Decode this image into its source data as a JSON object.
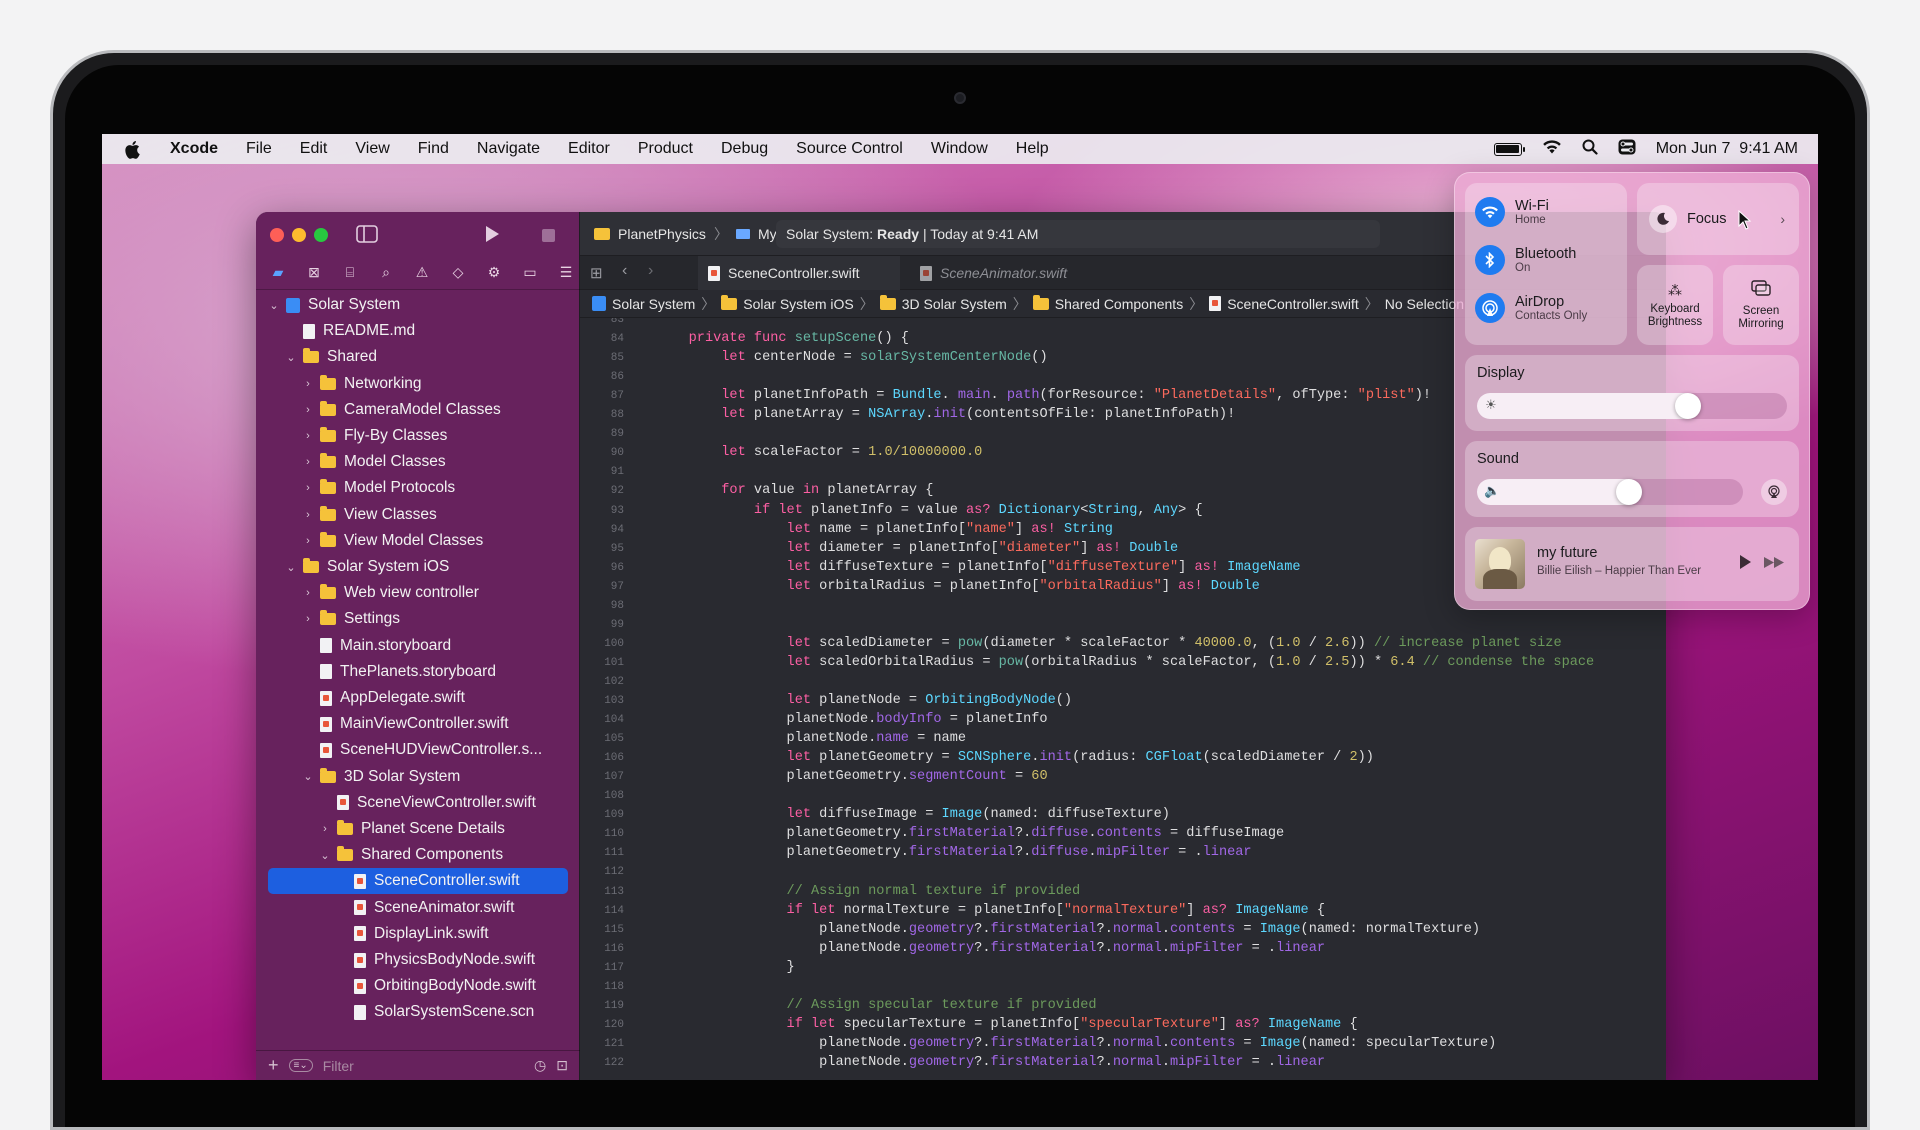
{
  "menubar": {
    "app_name": "Xcode",
    "menus": [
      "File",
      "Edit",
      "View",
      "Find",
      "Navigate",
      "Editor",
      "Product",
      "Debug",
      "Source Control",
      "Window",
      "Help"
    ],
    "clock": "Mon Jun 7  9:41 AM"
  },
  "toolbar": {
    "scheme": "PlanetPhysics",
    "destination": "My Mac",
    "status_prefix": "Solar System: ",
    "status_state": "Ready",
    "status_suffix": " | Today at 9:41 AM"
  },
  "tabs": [
    {
      "label": "SceneController.swift",
      "active": true
    },
    {
      "label": "SceneAnimator.swift",
      "active": false
    }
  ],
  "jumpbar": [
    "Solar System",
    "Solar System iOS",
    "3D Solar System",
    "Shared Components",
    "SceneController.swift",
    "No Selection"
  ],
  "navigator": {
    "filter_placeholder": "Filter",
    "items": [
      {
        "label": "Solar System",
        "level": 0,
        "type": "project",
        "expanded": true
      },
      {
        "label": "README.md",
        "level": 1,
        "type": "file"
      },
      {
        "label": "Shared",
        "level": 1,
        "type": "folder",
        "expanded": true
      },
      {
        "label": "Networking",
        "level": 2,
        "type": "folder",
        "expanded": false
      },
      {
        "label": "CameraModel Classes",
        "level": 2,
        "type": "folder",
        "expanded": false
      },
      {
        "label": "Fly-By Classes",
        "level": 2,
        "type": "folder",
        "expanded": false
      },
      {
        "label": "Model Classes",
        "level": 2,
        "type": "folder",
        "expanded": false
      },
      {
        "label": "Model Protocols",
        "level": 2,
        "type": "folder",
        "expanded": false
      },
      {
        "label": "View Classes",
        "level": 2,
        "type": "folder",
        "expanded": false
      },
      {
        "label": "View Model Classes",
        "level": 2,
        "type": "folder",
        "expanded": false
      },
      {
        "label": "Solar System iOS",
        "level": 1,
        "type": "folder",
        "expanded": true
      },
      {
        "label": "Web view controller",
        "level": 2,
        "type": "folder",
        "expanded": false
      },
      {
        "label": "Settings",
        "level": 2,
        "type": "folder",
        "expanded": false
      },
      {
        "label": "Main.storyboard",
        "level": 2,
        "type": "file"
      },
      {
        "label": "ThePlanets.storyboard",
        "level": 2,
        "type": "file"
      },
      {
        "label": "AppDelegate.swift",
        "level": 2,
        "type": "swift"
      },
      {
        "label": "MainViewController.swift",
        "level": 2,
        "type": "swift"
      },
      {
        "label": "SceneHUDViewController.s...",
        "level": 2,
        "type": "swift"
      },
      {
        "label": "3D Solar System",
        "level": 2,
        "type": "folder",
        "expanded": true
      },
      {
        "label": "SceneViewController.swift",
        "level": 3,
        "type": "swift"
      },
      {
        "label": "Planet Scene Details",
        "level": 3,
        "type": "folder",
        "expanded": false
      },
      {
        "label": "Shared Components",
        "level": 3,
        "type": "folder",
        "expanded": true
      },
      {
        "label": "SceneController.swift",
        "level": 4,
        "type": "swift",
        "selected": true
      },
      {
        "label": "SceneAnimator.swift",
        "level": 4,
        "type": "swift"
      },
      {
        "label": "DisplayLink.swift",
        "level": 4,
        "type": "swift"
      },
      {
        "label": "PhysicsBodyNode.swift",
        "level": 4,
        "type": "swift"
      },
      {
        "label": "OrbitingBodyNode.swift",
        "level": 4,
        "type": "swift"
      },
      {
        "label": "SolarSystemScene.scn",
        "level": 4,
        "type": "file"
      }
    ]
  },
  "code": [
    {
      "n": "83",
      "tokens": []
    },
    {
      "n": "84",
      "tokens": [
        [
          "",
          "    "
        ],
        [
          "kw",
          "private func "
        ],
        [
          "fn",
          "setupScene"
        ],
        [
          "",
          "() {"
        ]
      ]
    },
    {
      "n": "85",
      "tokens": [
        [
          "",
          "        "
        ],
        [
          "kw",
          "let "
        ],
        [
          "",
          "centerNode = "
        ],
        [
          "fn",
          "solarSystemCenterNode"
        ],
        [
          "",
          "()"
        ]
      ]
    },
    {
      "n": "86",
      "tokens": []
    },
    {
      "n": "87",
      "tokens": [
        [
          "",
          "        "
        ],
        [
          "kw",
          "let "
        ],
        [
          "",
          "planetInfoPath = "
        ],
        [
          "ty",
          "Bundle"
        ],
        [
          "",
          ". "
        ],
        [
          "pr",
          "main"
        ],
        [
          "",
          ". "
        ],
        [
          "pr",
          "path"
        ],
        [
          "",
          "(forResource: "
        ],
        [
          "st",
          "\"PlanetDetails\""
        ],
        [
          "",
          ", ofType: "
        ],
        [
          "st",
          "\"plist\""
        ],
        [
          "",
          ")!"
        ]
      ]
    },
    {
      "n": "88",
      "tokens": [
        [
          "",
          "        "
        ],
        [
          "kw",
          "let "
        ],
        [
          "",
          "planetArray = "
        ],
        [
          "ty",
          "NSArray"
        ],
        [
          "",
          "."
        ],
        [
          "pr",
          "init"
        ],
        [
          "",
          "(contentsOfFile: planetInfoPath)!"
        ]
      ]
    },
    {
      "n": "89",
      "tokens": []
    },
    {
      "n": "90",
      "tokens": [
        [
          "",
          "        "
        ],
        [
          "kw",
          "let "
        ],
        [
          "",
          "scaleFactor = "
        ],
        [
          "nu",
          "1.0/10000000.0"
        ]
      ]
    },
    {
      "n": "91",
      "tokens": []
    },
    {
      "n": "92",
      "tokens": [
        [
          "",
          "        "
        ],
        [
          "kw",
          "for "
        ],
        [
          "",
          "value "
        ],
        [
          "kw",
          "in "
        ],
        [
          "",
          "planetArray {"
        ]
      ]
    },
    {
      "n": "93",
      "tokens": [
        [
          "",
          "            "
        ],
        [
          "kw",
          "if let "
        ],
        [
          "",
          "planetInfo = value "
        ],
        [
          "kw",
          "as? "
        ],
        [
          "ty",
          "Dictionary"
        ],
        [
          "",
          "<"
        ],
        [
          "ty",
          "String"
        ],
        [
          "",
          ", "
        ],
        [
          "ty",
          "Any"
        ],
        [
          "",
          "> {"
        ]
      ]
    },
    {
      "n": "94",
      "tokens": [
        [
          "",
          "                "
        ],
        [
          "kw",
          "let "
        ],
        [
          "",
          "name = planetInfo["
        ],
        [
          "st",
          "\"name\""
        ],
        [
          "",
          "] "
        ],
        [
          "kw",
          "as! "
        ],
        [
          "ty",
          "String"
        ]
      ]
    },
    {
      "n": "95",
      "tokens": [
        [
          "",
          "                "
        ],
        [
          "kw",
          "let "
        ],
        [
          "",
          "diameter = planetInfo["
        ],
        [
          "st",
          "\"diameter\""
        ],
        [
          "",
          "] "
        ],
        [
          "kw",
          "as! "
        ],
        [
          "ty",
          "Double"
        ]
      ]
    },
    {
      "n": "96",
      "tokens": [
        [
          "",
          "                "
        ],
        [
          "kw",
          "let "
        ],
        [
          "",
          "diffuseTexture = planetInfo["
        ],
        [
          "st",
          "\"diffuseTexture\""
        ],
        [
          "",
          "] "
        ],
        [
          "kw",
          "as! "
        ],
        [
          "ty",
          "ImageName"
        ]
      ]
    },
    {
      "n": "97",
      "tokens": [
        [
          "",
          "                "
        ],
        [
          "kw",
          "let "
        ],
        [
          "",
          "orbitalRadius = planetInfo["
        ],
        [
          "st",
          "\"orbitalRadius\""
        ],
        [
          "",
          "] "
        ],
        [
          "kw",
          "as! "
        ],
        [
          "ty",
          "Double"
        ]
      ]
    },
    {
      "n": "98",
      "tokens": []
    },
    {
      "n": "99",
      "tokens": []
    },
    {
      "n": "100",
      "tokens": [
        [
          "",
          "                "
        ],
        [
          "kw",
          "let "
        ],
        [
          "",
          "scaledDiameter = "
        ],
        [
          "fn",
          "pow"
        ],
        [
          "",
          "(diameter * scaleFactor * "
        ],
        [
          "nu",
          "40000.0"
        ],
        [
          "",
          ", ("
        ],
        [
          "nu",
          "1.0"
        ],
        [
          "",
          " / "
        ],
        [
          "nu",
          "2.6"
        ],
        [
          "",
          "))"
        ],
        [
          "cm",
          " // increase planet size"
        ]
      ]
    },
    {
      "n": "101",
      "tokens": [
        [
          "",
          "                "
        ],
        [
          "kw",
          "let "
        ],
        [
          "",
          "scaledOrbitalRadius = "
        ],
        [
          "fn",
          "pow"
        ],
        [
          "",
          "(orbitalRadius * scaleFactor, ("
        ],
        [
          "nu",
          "1.0"
        ],
        [
          "",
          " / "
        ],
        [
          "nu",
          "2.5"
        ],
        [
          "",
          ")) * "
        ],
        [
          "nu",
          "6.4"
        ],
        [
          "cm",
          " // condense the space"
        ]
      ]
    },
    {
      "n": "102",
      "tokens": []
    },
    {
      "n": "103",
      "tokens": [
        [
          "",
          "                "
        ],
        [
          "kw",
          "let "
        ],
        [
          "",
          "planetNode = "
        ],
        [
          "ty",
          "OrbitingBodyNode"
        ],
        [
          "",
          "()"
        ]
      ]
    },
    {
      "n": "104",
      "tokens": [
        [
          "",
          "                planetNode."
        ],
        [
          "pr",
          "bodyInfo"
        ],
        [
          "",
          " = planetInfo"
        ]
      ]
    },
    {
      "n": "105",
      "tokens": [
        [
          "",
          "                planetNode."
        ],
        [
          "pr",
          "name"
        ],
        [
          "",
          " = name"
        ]
      ]
    },
    {
      "n": "106",
      "tokens": [
        [
          "",
          "                "
        ],
        [
          "kw",
          "let "
        ],
        [
          "",
          "planetGeometry = "
        ],
        [
          "ty",
          "SCNSphere"
        ],
        [
          "",
          "."
        ],
        [
          "pr",
          "init"
        ],
        [
          "",
          "(radius: "
        ],
        [
          "ty",
          "CGFloat"
        ],
        [
          "",
          "(scaledDiameter / "
        ],
        [
          "nu",
          "2"
        ],
        [
          "",
          "))"
        ]
      ]
    },
    {
      "n": "107",
      "tokens": [
        [
          "",
          "                planetGeometry."
        ],
        [
          "pr",
          "segmentCount"
        ],
        [
          "",
          " = "
        ],
        [
          "nu",
          "60"
        ]
      ]
    },
    {
      "n": "108",
      "tokens": []
    },
    {
      "n": "109",
      "tokens": [
        [
          "",
          "                "
        ],
        [
          "kw",
          "let "
        ],
        [
          "",
          "diffuseImage = "
        ],
        [
          "ty",
          "Image"
        ],
        [
          "",
          "(named: diffuseTexture)"
        ]
      ]
    },
    {
      "n": "110",
      "tokens": [
        [
          "",
          "                planetGeometry."
        ],
        [
          "pr",
          "firstMaterial"
        ],
        [
          "",
          "?."
        ],
        [
          "pr",
          "diffuse"
        ],
        [
          "",
          "."
        ],
        [
          "pr",
          "contents"
        ],
        [
          "",
          " = diffuseImage"
        ]
      ]
    },
    {
      "n": "111",
      "tokens": [
        [
          "",
          "                planetGeometry."
        ],
        [
          "pr",
          "firstMaterial"
        ],
        [
          "",
          "?."
        ],
        [
          "pr",
          "diffuse"
        ],
        [
          "",
          "."
        ],
        [
          "pr",
          "mipFilter"
        ],
        [
          "",
          " = ."
        ],
        [
          "pr",
          "linear"
        ]
      ]
    },
    {
      "n": "112",
      "tokens": []
    },
    {
      "n": "113",
      "tokens": [
        [
          "cm",
          "                // Assign normal texture if provided"
        ]
      ]
    },
    {
      "n": "114",
      "tokens": [
        [
          "",
          "                "
        ],
        [
          "kw",
          "if let "
        ],
        [
          "",
          "normalTexture = planetInfo["
        ],
        [
          "st",
          "\"normalTexture\""
        ],
        [
          "",
          "] "
        ],
        [
          "kw",
          "as? "
        ],
        [
          "ty",
          "ImageName"
        ],
        [
          "",
          " {"
        ]
      ]
    },
    {
      "n": "115",
      "tokens": [
        [
          "",
          "                    planetNode."
        ],
        [
          "pr",
          "geometry"
        ],
        [
          "",
          "?."
        ],
        [
          "pr",
          "firstMaterial"
        ],
        [
          "",
          "?."
        ],
        [
          "pr",
          "normal"
        ],
        [
          "",
          "."
        ],
        [
          "pr",
          "contents"
        ],
        [
          "",
          " = "
        ],
        [
          "ty",
          "Image"
        ],
        [
          "",
          "(named: normalTexture)"
        ]
      ]
    },
    {
      "n": "116",
      "tokens": [
        [
          "",
          "                    planetNode."
        ],
        [
          "pr",
          "geometry"
        ],
        [
          "",
          "?."
        ],
        [
          "pr",
          "firstMaterial"
        ],
        [
          "",
          "?."
        ],
        [
          "pr",
          "normal"
        ],
        [
          "",
          "."
        ],
        [
          "pr",
          "mipFilter"
        ],
        [
          "",
          " = ."
        ],
        [
          "pr",
          "linear"
        ]
      ]
    },
    {
      "n": "117",
      "tokens": [
        [
          "",
          "                }"
        ]
      ]
    },
    {
      "n": "118",
      "tokens": []
    },
    {
      "n": "119",
      "tokens": [
        [
          "cm",
          "                // Assign specular texture if provided"
        ]
      ]
    },
    {
      "n": "120",
      "tokens": [
        [
          "",
          "                "
        ],
        [
          "kw",
          "if let "
        ],
        [
          "",
          "specularTexture = planetInfo["
        ],
        [
          "st",
          "\"specularTexture\""
        ],
        [
          "",
          "] "
        ],
        [
          "kw",
          "as? "
        ],
        [
          "ty",
          "ImageName"
        ],
        [
          "",
          " {"
        ]
      ]
    },
    {
      "n": "121",
      "tokens": [
        [
          "",
          "                    planetNode."
        ],
        [
          "pr",
          "geometry"
        ],
        [
          "",
          "?."
        ],
        [
          "pr",
          "firstMaterial"
        ],
        [
          "",
          "?."
        ],
        [
          "pr",
          "normal"
        ],
        [
          "",
          "."
        ],
        [
          "pr",
          "contents"
        ],
        [
          "",
          " = "
        ],
        [
          "ty",
          "Image"
        ],
        [
          "",
          "(named: specularTexture)"
        ]
      ]
    },
    {
      "n": "122",
      "tokens": [
        [
          "",
          "                    planetNode."
        ],
        [
          "pr",
          "geometry"
        ],
        [
          "",
          "?."
        ],
        [
          "pr",
          "firstMaterial"
        ],
        [
          "",
          "?."
        ],
        [
          "pr",
          "normal"
        ],
        [
          "",
          "."
        ],
        [
          "pr",
          "mipFilter"
        ],
        [
          "",
          " = ."
        ],
        [
          "pr",
          "linear"
        ]
      ]
    }
  ],
  "control_center": {
    "wifi": {
      "title": "Wi-Fi",
      "sub": "Home"
    },
    "bluetooth": {
      "title": "Bluetooth",
      "sub": "On"
    },
    "airdrop": {
      "title": "AirDrop",
      "sub": "Contacts Only"
    },
    "focus": {
      "title": "Focus"
    },
    "keyboard_brightness": "Keyboard\nBrightness",
    "screen_mirroring": "Screen\nMirroring",
    "display": {
      "title": "Display",
      "level": 0.68
    },
    "sound": {
      "title": "Sound",
      "level": 0.57
    },
    "now_playing": {
      "title": "my future",
      "subtitle": "Billie Eilish – Happier Than Ever"
    }
  },
  "colors": {
    "accent": "#1d5fe0",
    "folder": "#f5c23a",
    "wifi": "#1f7bf0"
  }
}
